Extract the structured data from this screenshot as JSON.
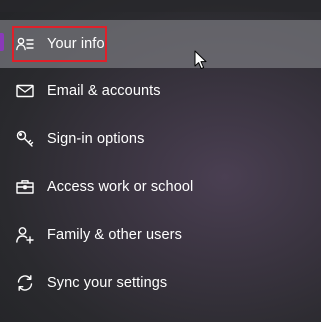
{
  "nav": {
    "items": [
      {
        "label": "Your info",
        "icon": "person-list-icon",
        "active": true
      },
      {
        "label": "Email & accounts",
        "icon": "mail-icon",
        "active": false
      },
      {
        "label": "Sign-in options",
        "icon": "key-icon",
        "active": false
      },
      {
        "label": "Access work or school",
        "icon": "briefcase-icon",
        "active": false
      },
      {
        "label": "Family & other users",
        "icon": "add-person-icon",
        "active": false
      },
      {
        "label": "Sync your settings",
        "icon": "sync-icon",
        "active": false
      }
    ]
  },
  "colors": {
    "accent": "#8a3ab9",
    "highlight_box": "#e0202a",
    "active_background": "#78787e"
  }
}
